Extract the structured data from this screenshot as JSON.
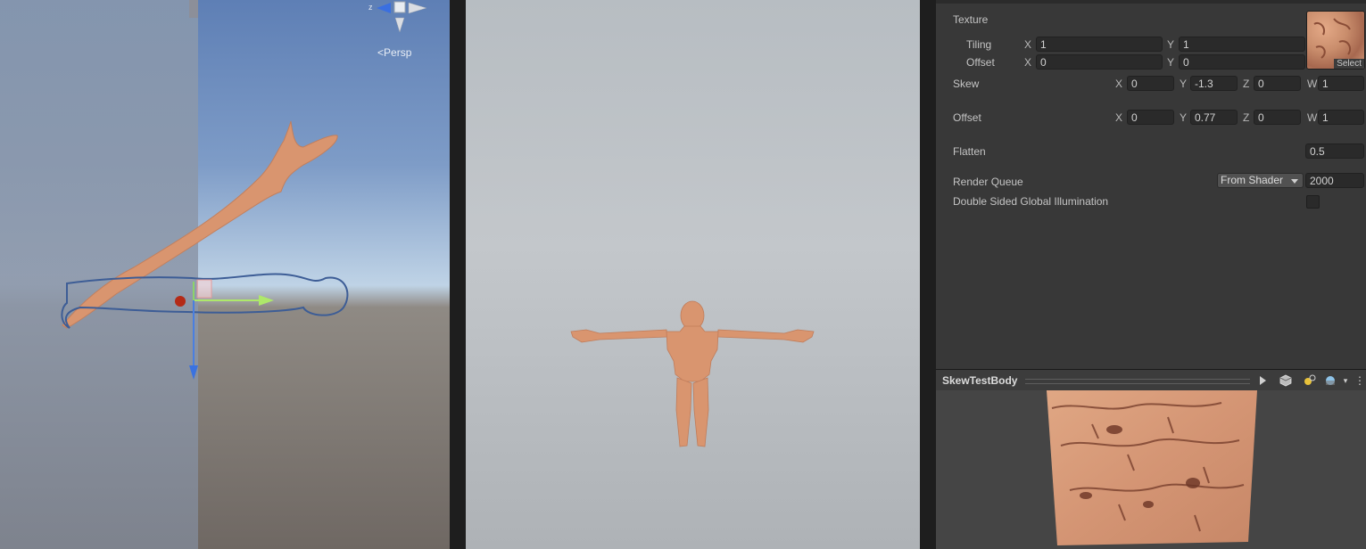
{
  "scene_view": {
    "gizmo_axis": "z",
    "projection_label": "Persp"
  },
  "inspector": {
    "texture": {
      "label": "Texture",
      "tiling": {
        "label": "Tiling",
        "x_label": "X",
        "x": "1",
        "y_label": "Y",
        "y": "1"
      },
      "offset": {
        "label": "Offset",
        "x_label": "X",
        "x": "0",
        "y_label": "Y",
        "y": "0"
      },
      "select_label": "Select"
    },
    "skew": {
      "label": "Skew",
      "x_label": "X",
      "x": "0",
      "y_label": "Y",
      "y": "-1.3",
      "z_label": "Z",
      "z": "0",
      "w_label": "W",
      "w": "1"
    },
    "offset": {
      "label": "Offset",
      "x_label": "X",
      "x": "0",
      "y_label": "Y",
      "y": "0.77",
      "z_label": "Z",
      "z": "0",
      "w_label": "W",
      "w": "1"
    },
    "flatten": {
      "label": "Flatten",
      "value": "0.5"
    },
    "render_queue": {
      "label": "Render Queue",
      "mode": "From Shader",
      "value": "2000"
    },
    "double_sided_gi": {
      "label": "Double Sided Global Illumination",
      "checked": false
    }
  },
  "preview": {
    "title": "SkewTestBody",
    "buttons": [
      "play-icon",
      "cube-icon",
      "lights-icon",
      "sphere-icon",
      "more-icon"
    ]
  },
  "colors": {
    "skin": "#d9956f",
    "inspector_bg": "#383838",
    "field_bg": "#2a2a2a",
    "scene_sky": "#7e9cc7",
    "game_bg": "#bfc3c7"
  }
}
